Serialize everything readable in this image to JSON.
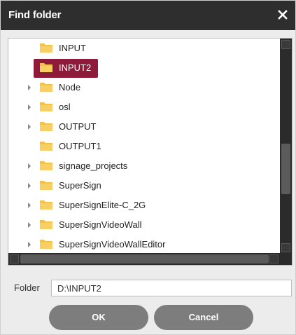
{
  "dialog": {
    "title": "Find folder",
    "close_icon": "close-icon"
  },
  "tree": {
    "items": [
      {
        "label": "INPUT",
        "expandable": false,
        "selected": false
      },
      {
        "label": "INPUT2",
        "expandable": false,
        "selected": true
      },
      {
        "label": "Node",
        "expandable": true,
        "selected": false
      },
      {
        "label": "osl",
        "expandable": true,
        "selected": false
      },
      {
        "label": "OUTPUT",
        "expandable": true,
        "selected": false
      },
      {
        "label": "OUTPUT1",
        "expandable": false,
        "selected": false
      },
      {
        "label": "signage_projects",
        "expandable": true,
        "selected": false
      },
      {
        "label": "SuperSign",
        "expandable": true,
        "selected": false
      },
      {
        "label": "SuperSignElite-C_2G",
        "expandable": true,
        "selected": false
      },
      {
        "label": "SuperSignVideoWall",
        "expandable": true,
        "selected": false
      },
      {
        "label": "SuperSignVideoWallEditor",
        "expandable": true,
        "selected": false
      }
    ],
    "icons": {
      "folder": "folder-icon",
      "expander": "chevron-right-icon"
    }
  },
  "folder_field": {
    "label": "Folder",
    "value": "D:\\INPUT2"
  },
  "buttons": {
    "ok": "OK",
    "cancel": "Cancel"
  },
  "colors": {
    "titlebar": "#2e2e2e",
    "selection": "#8f1b3a",
    "folder": "#f5c247",
    "button": "#7d7d7d"
  }
}
